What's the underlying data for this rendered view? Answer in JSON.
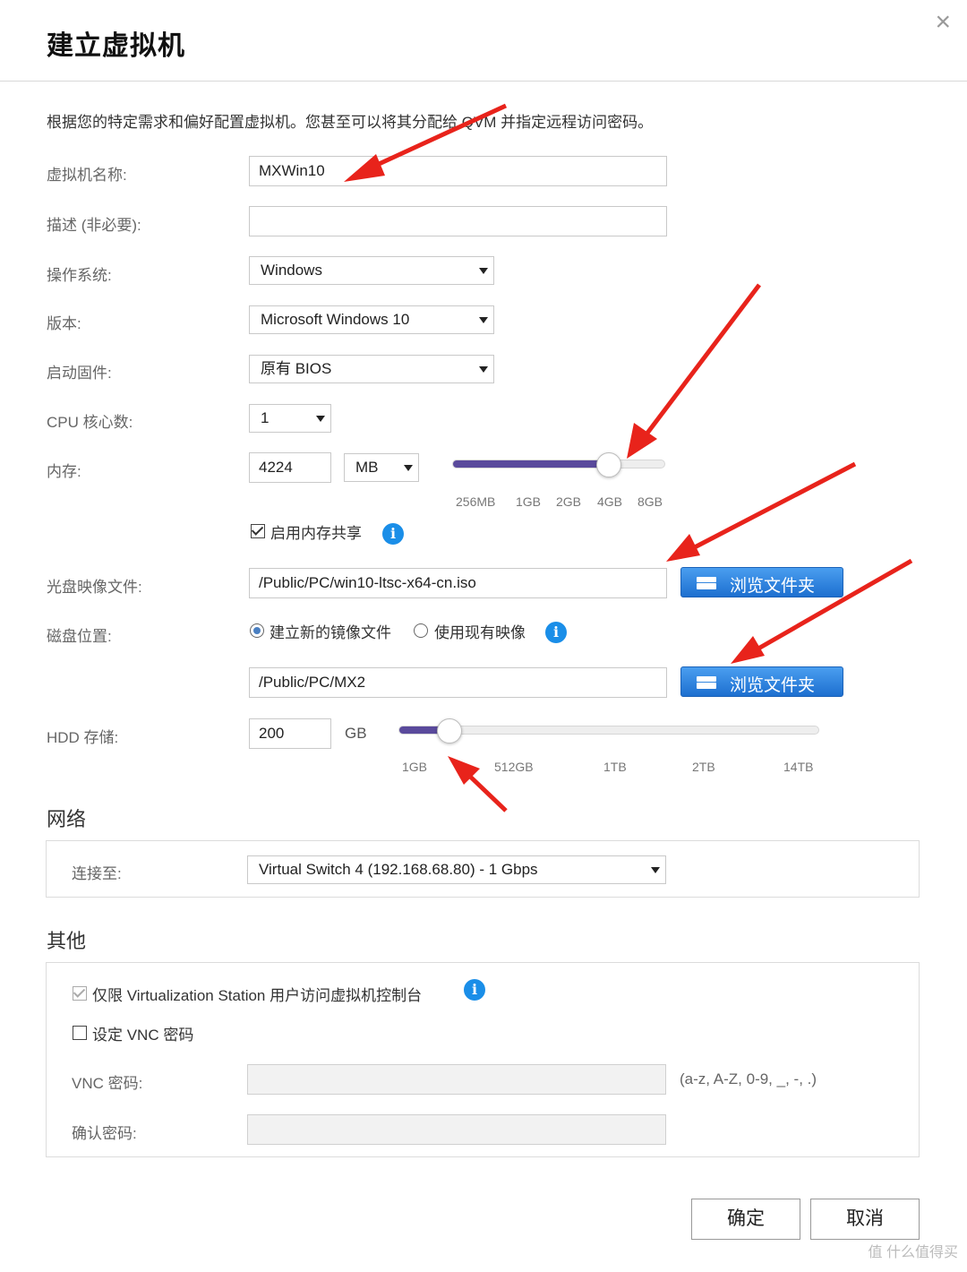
{
  "dialog": {
    "title": "建立虚拟机",
    "close": "×",
    "intro": "根据您的特定需求和偏好配置虚拟机。您甚至可以将其分配给 QVM 并指定远程访问密码。"
  },
  "form": {
    "name_label": "虚拟机名称:",
    "name_value": "MXWin10",
    "desc_label": "描述 (非必要):",
    "desc_value": "",
    "os_label": "操作系统:",
    "os_value": "Windows",
    "version_label": "版本:",
    "version_value": "Microsoft Windows 10",
    "firmware_label": "启动固件:",
    "firmware_value": "原有 BIOS",
    "cpu_label": "CPU 核心数:",
    "cpu_value": "1",
    "memory_label": "内存:",
    "memory_value": "4224",
    "memory_unit": "MB",
    "memory_slider_fraction": 0.73,
    "memory_ticks": [
      "256MB",
      "1GB",
      "2GB",
      "4GB",
      "8GB"
    ],
    "memory_share_label": "启用内存共享",
    "memory_share_checked": true,
    "iso_label": "光盘映像文件:",
    "iso_value": "/Public/PC/win10-ltsc-x64-cn.iso",
    "browse_label": "浏览文件夹",
    "disk_label": "磁盘位置:",
    "disk_option_new": "建立新的镜像文件",
    "disk_option_existing": "使用现有映像",
    "disk_selected": "new",
    "disk_path_value": "/Public/PC/MX2",
    "hdd_label": "HDD 存储:",
    "hdd_value": "200",
    "hdd_unit": "GB",
    "hdd_slider_fraction": 0.12,
    "hdd_ticks": [
      "1GB",
      "512GB",
      "1TB",
      "2TB",
      "14TB"
    ]
  },
  "network": {
    "section_title": "网络",
    "connect_label": "连接至:",
    "connect_value": "Virtual Switch 4 (192.168.68.80) - 1 Gbps"
  },
  "other": {
    "section_title": "其他",
    "restrict_label": "仅限 Virtualization Station 用户访问虚拟机控制台",
    "restrict_checked": true,
    "vnc_set_label": "设定 VNC 密码",
    "vnc_set_checked": false,
    "vnc_pwd_label": "VNC 密码:",
    "vnc_hint": "(a-z, A-Z, 0-9, _, -, .)",
    "confirm_pwd_label": "确认密码:"
  },
  "buttons": {
    "ok": "确定",
    "cancel": "取消"
  },
  "watermark": "值 什么值得买",
  "colors": {
    "accent_blue": "#1d6fd0",
    "slider_fill": "#5a4a9c",
    "annotation_red": "#e8231b"
  }
}
